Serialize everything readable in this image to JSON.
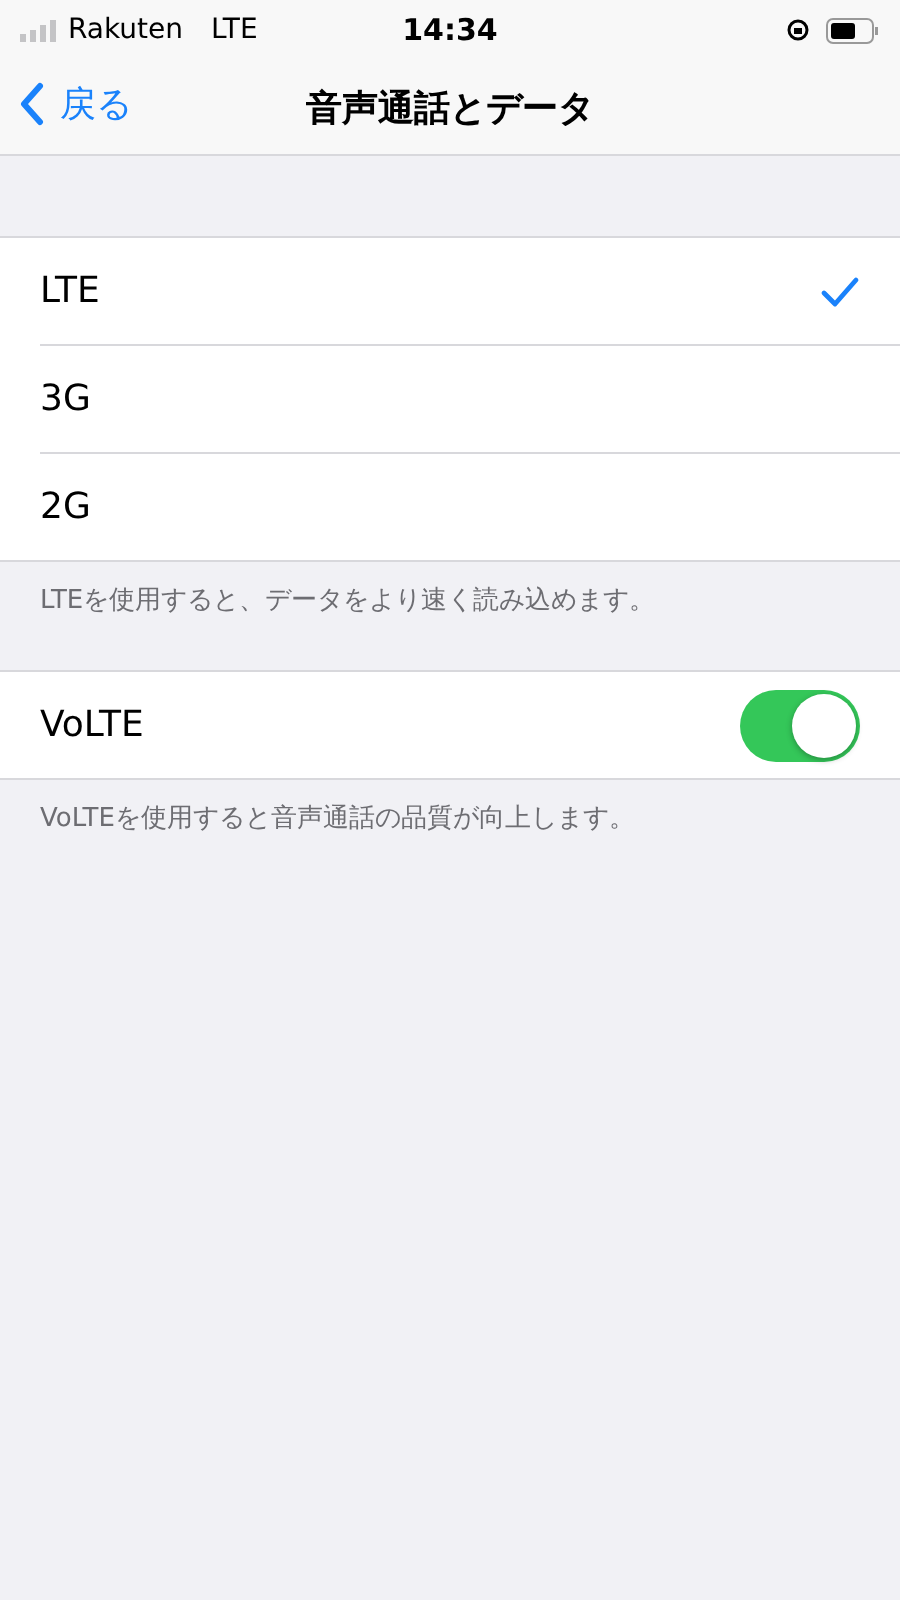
{
  "status_bar": {
    "carrier": "Rakuten",
    "network": "LTE",
    "time": "14:34"
  },
  "nav": {
    "back": "戻る",
    "title": "音声通話とデータ"
  },
  "options": [
    {
      "label": "LTE",
      "selected": true
    },
    {
      "label": "3G",
      "selected": false
    },
    {
      "label": "2G",
      "selected": false
    }
  ],
  "options_footer": "LTEを使用すると、データをより速く読み込めます。",
  "volte": {
    "label": "VoLTE",
    "on": true
  },
  "volte_footer": "VoLTEを使用すると音声通話の品質が向上します。"
}
